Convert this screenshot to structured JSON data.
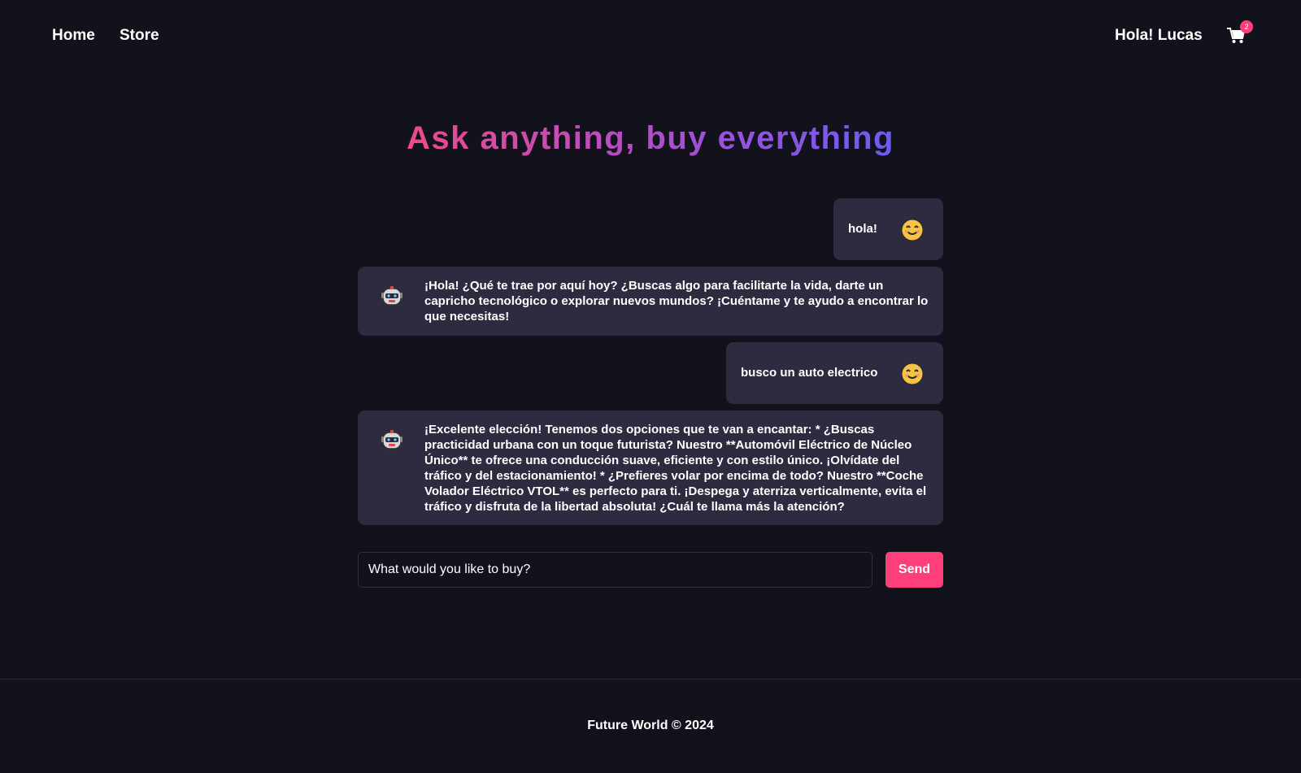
{
  "nav": {
    "home": "Home",
    "store": "Store"
  },
  "header": {
    "greeting": "Hola! Lucas",
    "cart_count": "2",
    "cart_icon": "shopping-cart-icon"
  },
  "hero": {
    "title": "Ask anything, buy everything"
  },
  "chat": {
    "messages": [
      {
        "role": "user",
        "text": "hola!",
        "icon": "smiling-face-icon"
      },
      {
        "role": "bot",
        "text": "¡Hola! ¿Qué te trae por aquí hoy? ¿Buscas algo para facilitarte la vida, darte un capricho tecnológico o explorar nuevos mundos? ¡Cuéntame y te ayudo a encontrar lo que necesitas!",
        "icon": "robot-icon"
      },
      {
        "role": "user",
        "text": "busco un auto electrico",
        "icon": "smiling-face-icon"
      },
      {
        "role": "bot",
        "text": "¡Excelente elección! Tenemos dos opciones que te van a encantar: * ¿Buscas practicidad urbana con un toque futurista? Nuestro **Automóvil Eléctrico de Núcleo Único** te ofrece una conducción suave, eficiente y con estilo único. ¡Olvídate del tráfico y del estacionamiento! * ¿Prefieres volar por encima de todo? Nuestro **Coche Volador Eléctrico VTOL** es perfecto para ti. ¡Despega y aterriza verticalmente, evita el tráfico y disfruta de la libertad absoluta! ¿Cuál te llama más la atención?",
        "icon": "robot-icon"
      }
    ]
  },
  "input": {
    "placeholder": "What would you like to buy?",
    "send_label": "Send"
  },
  "footer": {
    "text": "Future World © 2024"
  },
  "colors": {
    "accent": "#ff3f7a",
    "background": "#12121c",
    "bubble": "#2e2b40",
    "title_gradient_start": "#ec4a8a",
    "title_gradient_end": "#6b5cf0"
  }
}
